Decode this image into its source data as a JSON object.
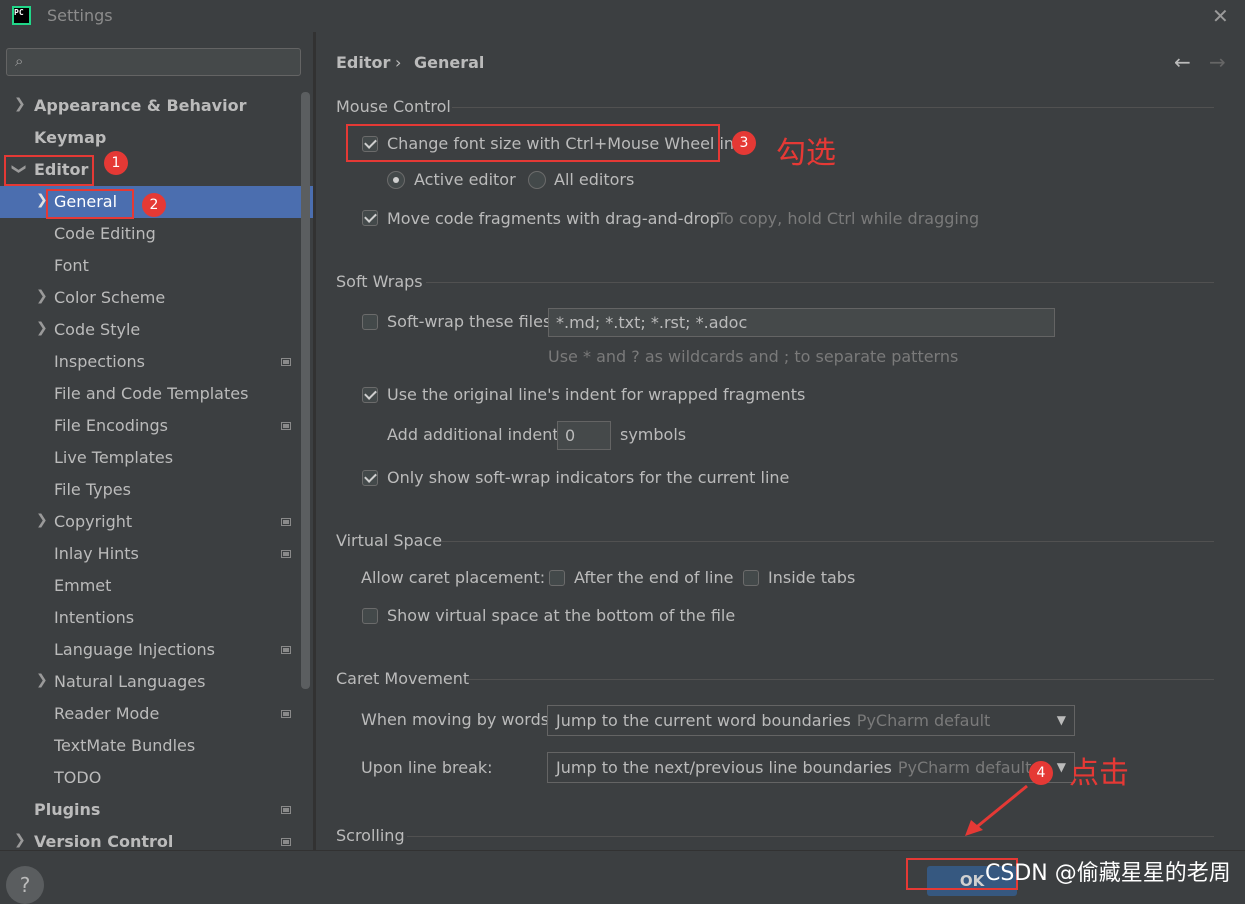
{
  "window": {
    "title": "Settings",
    "app_icon_text": "PC"
  },
  "search": {
    "placeholder": "",
    "value": ""
  },
  "sidebar": {
    "items": [
      {
        "label": "Appearance & Behavior"
      },
      {
        "label": "Keymap"
      },
      {
        "label": "Editor"
      },
      {
        "label": "General"
      },
      {
        "label": "Code Editing"
      },
      {
        "label": "Font"
      },
      {
        "label": "Color Scheme"
      },
      {
        "label": "Code Style"
      },
      {
        "label": "Inspections"
      },
      {
        "label": "File and Code Templates"
      },
      {
        "label": "File Encodings"
      },
      {
        "label": "Live Templates"
      },
      {
        "label": "File Types"
      },
      {
        "label": "Copyright"
      },
      {
        "label": "Inlay Hints"
      },
      {
        "label": "Emmet"
      },
      {
        "label": "Intentions"
      },
      {
        "label": "Language Injections"
      },
      {
        "label": "Natural Languages"
      },
      {
        "label": "Reader Mode"
      },
      {
        "label": "TextMate Bundles"
      },
      {
        "label": "TODO"
      },
      {
        "label": "Plugins"
      },
      {
        "label": "Version Control"
      }
    ]
  },
  "breadcrumb": {
    "parent": "Editor",
    "separator": "›",
    "current": "General"
  },
  "mouse_control": {
    "title": "Mouse Control",
    "change_font_size": {
      "label": "Change font size with Ctrl+Mouse Wheel in:",
      "checked": true
    },
    "active_editor": {
      "label": "Active editor",
      "selected": true
    },
    "all_editors": {
      "label": "All editors",
      "selected": false
    },
    "move_code": {
      "label": "Move code fragments with drag-and-drop",
      "checked": true
    },
    "move_code_hint": "To copy, hold Ctrl while dragging"
  },
  "soft_wraps": {
    "title": "Soft Wraps",
    "soft_wrap_files": {
      "label": "Soft-wrap these files:",
      "checked": false
    },
    "patterns": "*.md; *.txt; *.rst; *.adoc",
    "patterns_hint": "Use * and ? as wildcards and ; to separate patterns",
    "original_indent": {
      "label": "Use the original line's indent for wrapped fragments",
      "checked": true
    },
    "additional_indent_label": "Add additional indent:",
    "additional_indent_value": "0",
    "symbols_label": "symbols",
    "only_show_indicators": {
      "label": "Only show soft-wrap indicators for the current line",
      "checked": true
    }
  },
  "virtual_space": {
    "title": "Virtual Space",
    "allow_caret_label": "Allow caret placement:",
    "after_end_of_line": {
      "label": "After the end of line",
      "checked": false
    },
    "inside_tabs": {
      "label": "Inside tabs",
      "checked": false
    },
    "show_virtual_space": {
      "label": "Show virtual space at the bottom of the file",
      "checked": false
    }
  },
  "caret_movement": {
    "title": "Caret Movement",
    "by_words_label": "When moving by words:",
    "by_words_value": "Jump to the current word boundaries",
    "by_words_hint": "PyCharm default",
    "line_break_label": "Upon line break:",
    "line_break_value": "Jump to the next/previous line boundaries",
    "line_break_hint": "PyCharm default"
  },
  "scrolling": {
    "title": "Scrolling"
  },
  "buttons": {
    "ok": "OK",
    "help": "?"
  },
  "annotations": {
    "badge1": "1",
    "badge2": "2",
    "badge3": "3",
    "badge4": "4",
    "check_text": "勾选",
    "click_text": "点击",
    "accent_color": "#e53935"
  },
  "watermark": "CSDN @偷藏星星的老周",
  "colors": {
    "background": "#3c3f41",
    "selection": "#4b6eaf",
    "ok_button": "#365880"
  }
}
